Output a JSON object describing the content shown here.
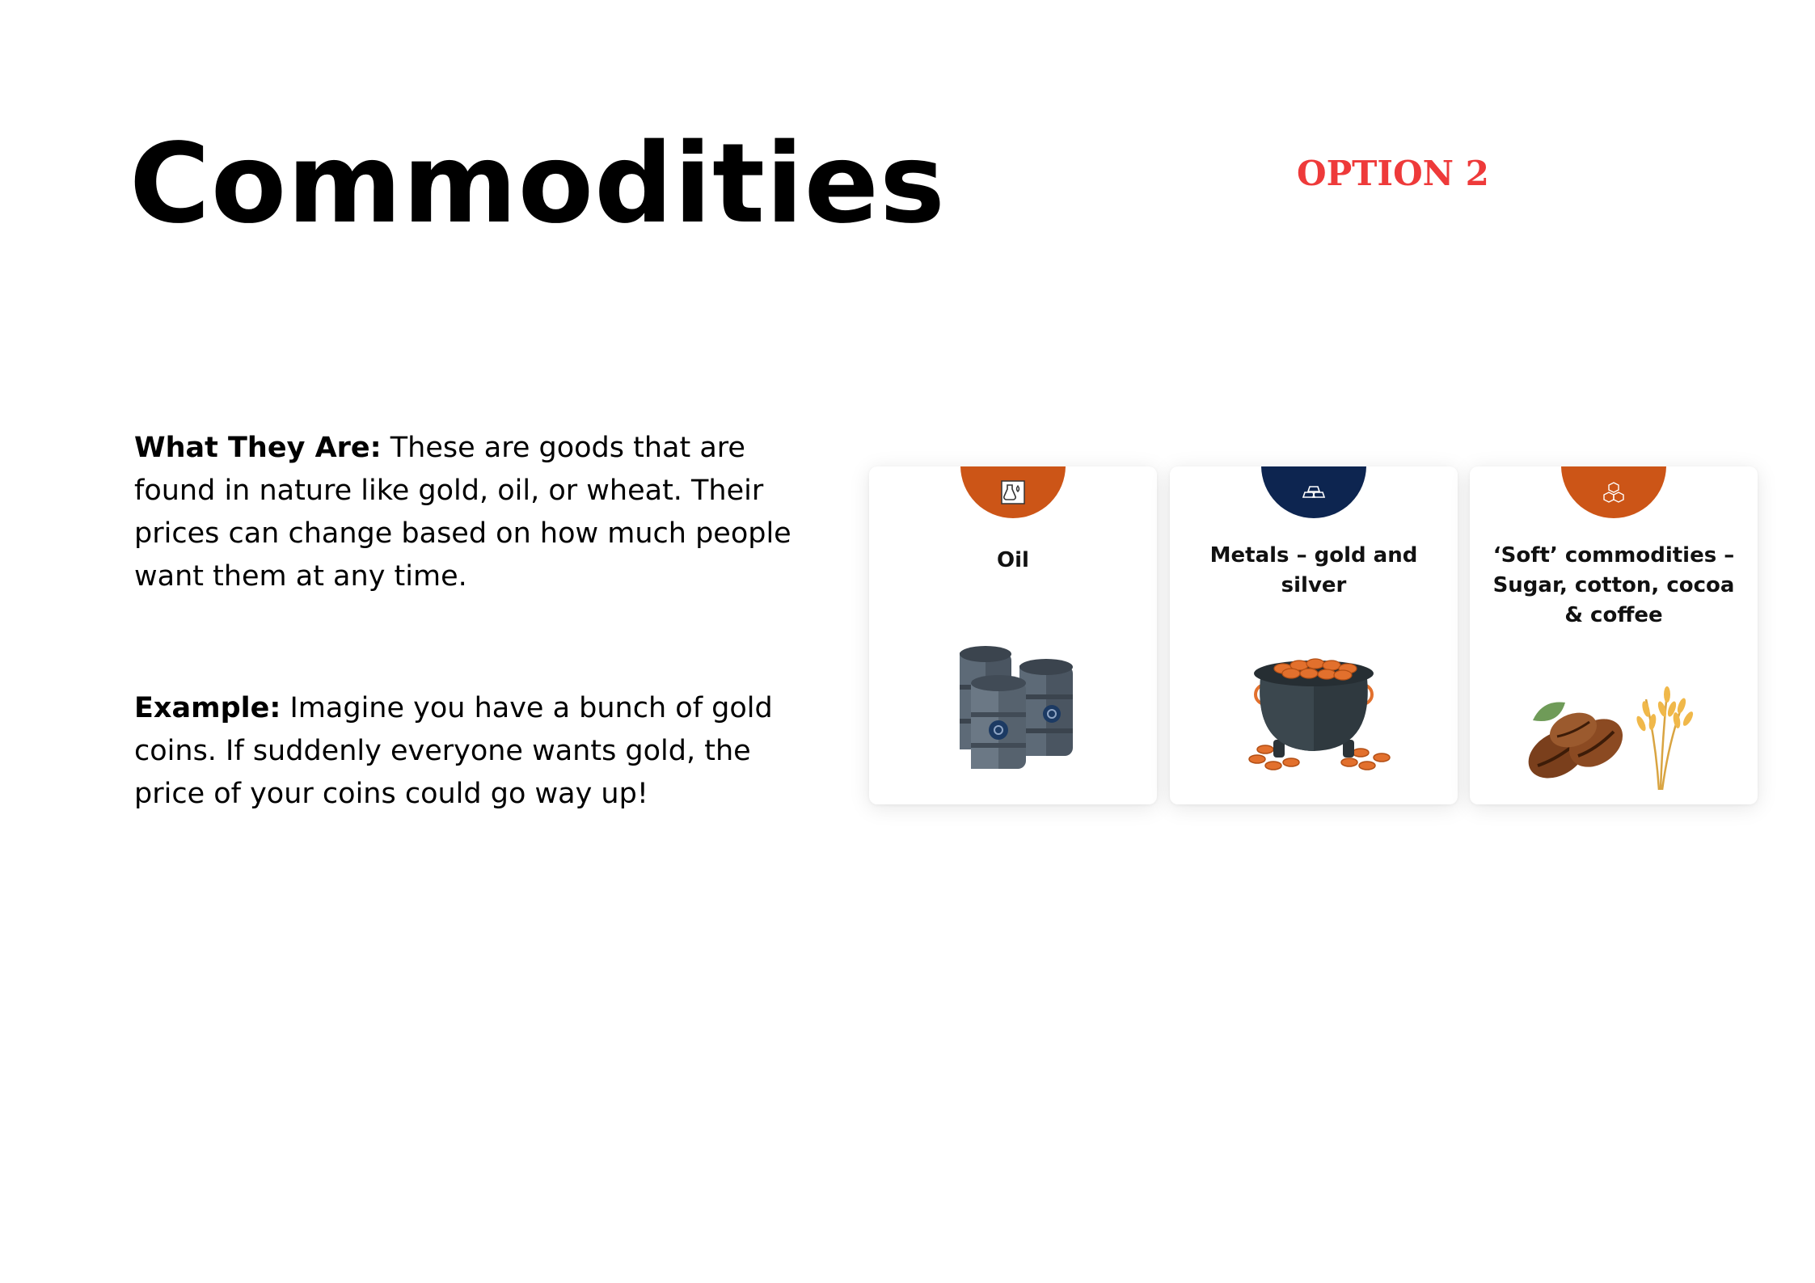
{
  "title": "Commodities",
  "option_tag": "OPTION 2",
  "paragraphs": {
    "what": {
      "label": "What They Are:",
      "text": " These are goods that are found in nature like gold, oil, or wheat. Their prices can change based on how much people want them at any time."
    },
    "example": {
      "label": "Example:",
      "text": " Imagine you have a bunch of gold coins. If suddenly everyone wants gold, the price of your coins could go way up!"
    }
  },
  "cards": [
    {
      "label": "Oil",
      "badge_color": "#cc5517",
      "icon": "oil-flask-icon",
      "illustration": "oil-barrels"
    },
    {
      "label": "Metals – gold and silver",
      "badge_color": "#0d2550",
      "icon": "gold-bars-icon",
      "illustration": "pot-of-coins"
    },
    {
      "label": "‘Soft’ commodities – Sugar, cotton, cocoa & coffee",
      "badge_color": "#cc5517",
      "icon": "sugar-cubes-icon",
      "illustration": "coffee-beans-and-wheat"
    }
  ]
}
